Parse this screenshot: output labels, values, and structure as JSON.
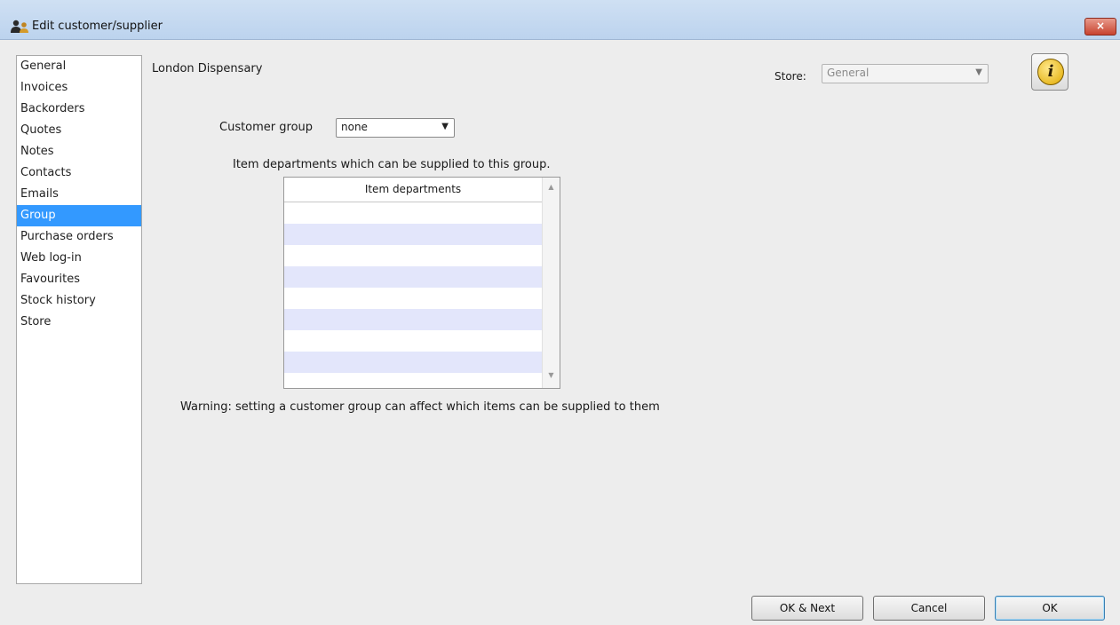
{
  "window": {
    "title": "Edit customer/supplier",
    "close_label": "×"
  },
  "sidebar": {
    "items": [
      {
        "label": "General"
      },
      {
        "label": "Invoices"
      },
      {
        "label": "Backorders"
      },
      {
        "label": "Quotes"
      },
      {
        "label": "Notes"
      },
      {
        "label": "Contacts"
      },
      {
        "label": "Emails"
      },
      {
        "label": "Group",
        "selected": true
      },
      {
        "label": "Purchase orders"
      },
      {
        "label": "Web log-in"
      },
      {
        "label": "Favourites"
      },
      {
        "label": "Stock history"
      },
      {
        "label": "Store"
      }
    ]
  },
  "header": {
    "name": "London Dispensary",
    "store_label": "Store:",
    "store_value": "General",
    "info_icon": "i"
  },
  "group": {
    "customer_group_label": "Customer group",
    "customer_group_value": "none",
    "description": "Item departments which can be supplied to this group.",
    "table_header": "Item departments",
    "rows": [],
    "warning": "Warning: setting a customer group can affect which items can be supplied to them"
  },
  "footer": {
    "ok_next_label": "OK & Next",
    "cancel_label": "Cancel",
    "ok_label": "OK"
  },
  "colors": {
    "selection": "#3399ff",
    "row_alt": "#e3e6fb",
    "titlebar": "#bcd3ee"
  },
  "icons": {
    "app": "people-icon",
    "close": "close-icon",
    "info": "info-icon",
    "dropdown": "chevron-down-icon"
  }
}
